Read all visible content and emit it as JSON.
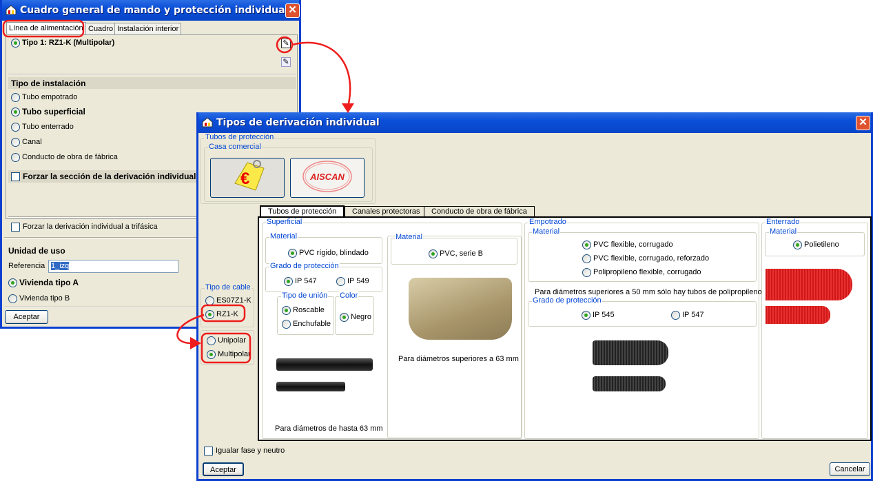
{
  "main_window": {
    "title": "Cuadro general de mando y protección individual",
    "tabs": [
      "Línea de alimentación",
      "Cuadro",
      "Instalación interior"
    ],
    "cable_type": "Tipo 1: RZ1-K (Multipolar)",
    "install_header": "Tipo de instalación",
    "install_options": [
      {
        "label": "Tubo empotrado",
        "selected": false
      },
      {
        "label": "Tubo superficial",
        "selected": true
      },
      {
        "label": "Tubo enterrado",
        "selected": false
      },
      {
        "label": "Canal",
        "selected": false
      },
      {
        "label": "Conducto de obra de fábrica",
        "selected": false
      }
    ],
    "force_section": "Forzar la sección de la derivación individual",
    "force_three_phase": "Forzar la derivación individual a trifásica",
    "unit_header": "Unidad de uso",
    "reference_label": "Referencia",
    "reference_value": "1_izq",
    "dwelling_options": [
      {
        "label": "Vivienda tipo A",
        "selected": true
      },
      {
        "label": "Vivienda tipo B",
        "selected": false
      }
    ],
    "accept": "Aceptar"
  },
  "dialog": {
    "title": "Tipos de derivación individual",
    "protection_group": "Tubos de protección",
    "brand_group": "Casa comercial",
    "brand_logo": "AISCAN",
    "cable_type_group": "Tipo de cable",
    "cable_types": [
      {
        "label": "ES07Z1-K",
        "selected": false
      },
      {
        "label": "RZ1-K",
        "selected": true
      }
    ],
    "poles": [
      {
        "label": "Unipolar",
        "selected": false
      },
      {
        "label": "Multipolar",
        "selected": true
      }
    ],
    "tabs": [
      "Tubos de protección",
      "Canales protectoras",
      "Conducto de obra de fábrica"
    ],
    "superficial": {
      "label": "Superficial",
      "material_label": "Material",
      "material": "PVC rígido, blindado",
      "grade_label": "Grado de protección",
      "grades": [
        {
          "label": "IP 547",
          "selected": true
        },
        {
          "label": "IP 549",
          "selected": false
        }
      ],
      "join_label": "Tipo de unión",
      "joins": [
        {
          "label": "Roscable",
          "selected": true
        },
        {
          "label": "Enchufable",
          "selected": false
        }
      ],
      "color_label": "Color",
      "color": "Negro",
      "note": "Para diámetros de hasta 63 mm",
      "material2_label": "Material",
      "material2": "PVC, serie B",
      "note2": "Para diámetros superiores a 63 mm"
    },
    "empotrado": {
      "label": "Empotrado",
      "material_label": "Material",
      "materials": [
        {
          "label": "PVC flexible, corrugado",
          "selected": true
        },
        {
          "label": "PVC flexible, corrugado, reforzado",
          "selected": false
        },
        {
          "label": "Polipropileno flexible, corrugado",
          "selected": false
        }
      ],
      "note": "Para diámetros superiores a 50 mm sólo hay tubos de polipropileno",
      "grade_label": "Grado de protección",
      "grades": [
        {
          "label": "IP 545",
          "selected": true
        },
        {
          "label": "IP 547",
          "selected": false
        }
      ]
    },
    "enterrado": {
      "label": "Enterrado",
      "material_label": "Material",
      "material": "Polietileno"
    },
    "equalize": "Igualar fase y neutro",
    "accept": "Aceptar",
    "cancel": "Cancelar"
  },
  "colors": {
    "title_bar": "#0a4fd8",
    "annotation": "#ee1c1c",
    "panel": "#ece9d8"
  }
}
